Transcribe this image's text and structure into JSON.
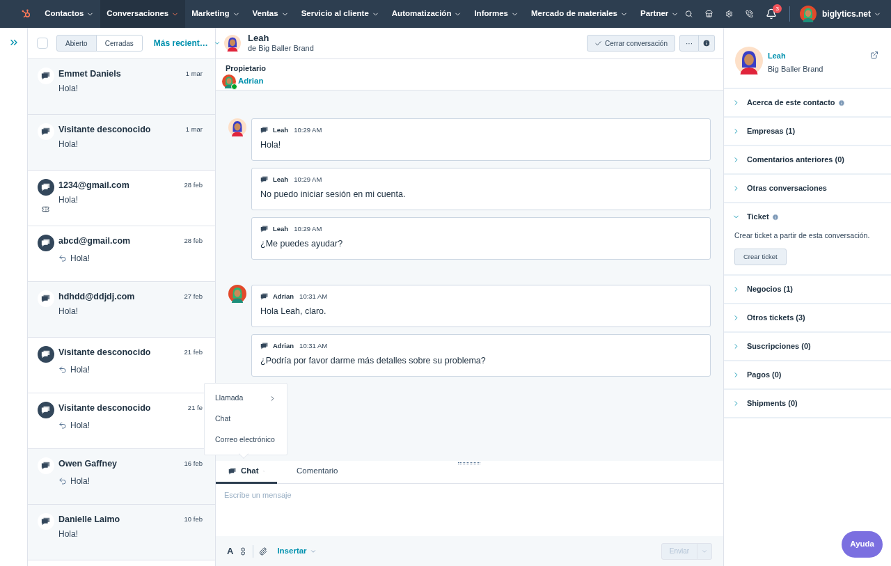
{
  "nav": {
    "items": [
      {
        "label": "Contactos",
        "selected": false
      },
      {
        "label": "Conversaciones",
        "selected": true
      },
      {
        "label": "Marketing",
        "selected": false
      },
      {
        "label": "Ventas",
        "selected": false
      },
      {
        "label": "Servicio al cliente",
        "selected": false
      },
      {
        "label": "Automatización",
        "selected": false
      },
      {
        "label": "Informes",
        "selected": false
      },
      {
        "label": "Mercado de materiales",
        "selected": false
      },
      {
        "label": "Partner",
        "selected": false
      }
    ],
    "notifications": "3",
    "account": "biglytics.net"
  },
  "list_header": {
    "filters": [
      {
        "label": "Abierto",
        "selected": true
      },
      {
        "label": "Cerradas",
        "selected": false
      }
    ],
    "sort": "Más recient…",
    "checked": false
  },
  "conversations": [
    {
      "name": "Emmet Daniels",
      "date": "1 mar",
      "preview": "Hola!",
      "unread": false,
      "replied": false,
      "ticket": false
    },
    {
      "name": "Visitante desconocido",
      "date": "1 mar",
      "preview": "Hola!",
      "unread": false,
      "replied": false,
      "ticket": false
    },
    {
      "name": "1234@gmail.com",
      "date": "28 feb",
      "preview": "Hola!",
      "unread": true,
      "replied": false,
      "ticket": true
    },
    {
      "name": "abcd@gmail.com",
      "date": "28 feb",
      "preview": "Hola!",
      "unread": true,
      "replied": true,
      "ticket": false
    },
    {
      "name": "hdhdd@ddjdj.com",
      "date": "27 feb",
      "preview": "Hola!",
      "unread": false,
      "replied": false,
      "ticket": false
    },
    {
      "name": "Visitante desconocido",
      "date": "21 feb",
      "preview": "Hola!",
      "unread": true,
      "replied": true,
      "ticket": false
    },
    {
      "name": "Visitante desconocido",
      "date": "21 fe",
      "preview": "Hola!",
      "unread": true,
      "replied": true,
      "ticket": false
    },
    {
      "name": "Owen Gaffney",
      "date": "16 feb",
      "preview": "Hola!",
      "unread": false,
      "replied": true,
      "ticket": false
    },
    {
      "name": "Danielle Laimo",
      "date": "10 feb",
      "preview": "Hola!",
      "unread": false,
      "replied": false,
      "ticket": false
    }
  ],
  "thread_header": {
    "name": "Leah",
    "company": "de Big Baller Brand",
    "close_button": "Cerrar conversación",
    "more": "···"
  },
  "owner": {
    "label": "Propietario",
    "name": "Adrian",
    "online": true
  },
  "messages": [
    {
      "author": "Leah",
      "time": "10:29 AM",
      "text": "Hola!",
      "show_avatar": true,
      "kind": "customer"
    },
    {
      "author": "Leah",
      "time": "10:29 AM",
      "text": "No puedo iniciar sesión en mi cuenta.",
      "show_avatar": false
    },
    {
      "author": "Leah",
      "time": "10:29 AM",
      "text": "¿Me puedes ayudar?",
      "show_avatar": false
    },
    {
      "author": "Adrian",
      "time": "10:31 AM",
      "text": "Hola Leah, claro.",
      "show_avatar": true,
      "kind": "agent"
    },
    {
      "author": "Adrian",
      "time": "10:31 AM",
      "text": "¿Podría por favor darme más detalles sobre su problema?",
      "show_avatar": false
    }
  ],
  "channel_menu": {
    "items": [
      {
        "label": "Llamada",
        "submenu": true
      },
      {
        "label": "Chat",
        "submenu": false
      },
      {
        "label": "Correo electrónico",
        "submenu": false
      }
    ]
  },
  "composer": {
    "tabs": [
      {
        "label": "Chat",
        "selected": true,
        "dropdown": true
      },
      {
        "label": "Comentario",
        "selected": false,
        "dropdown": false
      }
    ],
    "placeholder": "Escribe un mensaje",
    "format": "A",
    "insert": "Insertar",
    "send": "Enviar",
    "send_disabled": true
  },
  "contact": {
    "name": "Leah",
    "company": "Big Baller Brand"
  },
  "sections": [
    {
      "title": "Acerca de este contacto",
      "info": true,
      "expanded": false
    },
    {
      "title": "Empresas (1)",
      "info": false,
      "expanded": false
    },
    {
      "title": "Comentarios anteriores (0)",
      "info": false,
      "expanded": false
    },
    {
      "title": "Otras conversaciones",
      "info": false,
      "expanded": false
    },
    {
      "title": "Ticket",
      "info": true,
      "expanded": true,
      "body": "Crear ticket a partir de esta conversación.",
      "button": "Crear ticket"
    },
    {
      "title": "Negocios (1)",
      "info": false,
      "expanded": false
    },
    {
      "title": "Otros tickets (3)",
      "info": false,
      "expanded": false
    },
    {
      "title": "Suscripciones (0)",
      "info": false,
      "expanded": false
    },
    {
      "title": "Pagos (0)",
      "info": false,
      "expanded": false
    },
    {
      "title": "Shipments (0)",
      "info": false,
      "expanded": false
    }
  ],
  "help_button": "Ayuda"
}
